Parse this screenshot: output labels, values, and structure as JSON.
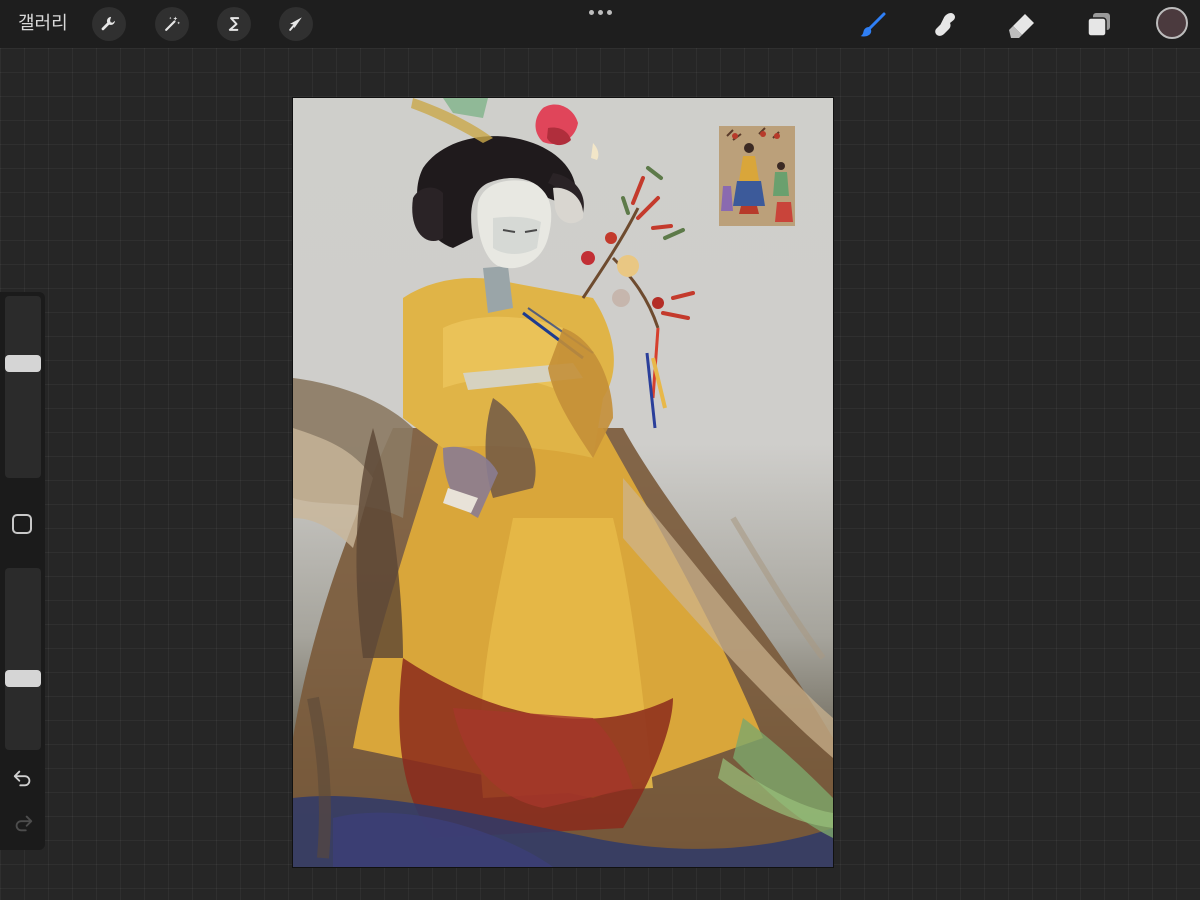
{
  "toolbar": {
    "gallery_label": "갤러리",
    "actions_icon": "wrench-icon",
    "adjustments_icon": "magic-wand-icon",
    "selection_icon": "selection-s-icon",
    "transform_icon": "arrow-cursor-icon",
    "more_icon": "ellipsis-icon",
    "brush_icon": "brush-icon",
    "smudge_icon": "smudge-finger-icon",
    "eraser_icon": "eraser-icon",
    "layers_icon": "layers-icon",
    "active_tool": "brush",
    "current_color": "#4b3a3e",
    "brush_color": "#2f7ff5"
  },
  "sidebar": {
    "brush_size_icon": "slider",
    "modify_icon": "square-icon",
    "opacity_icon": "slider",
    "undo_icon": "undo-arrow-icon",
    "redo_icon": "redo-arrow-icon",
    "brush_size_level": 0.64,
    "opacity_level": 0.38,
    "redo_enabled": false
  },
  "canvas": {
    "artwork": "painting-of-figure-in-yellow-hanbok",
    "reference_image": "reference-thumbnail"
  }
}
